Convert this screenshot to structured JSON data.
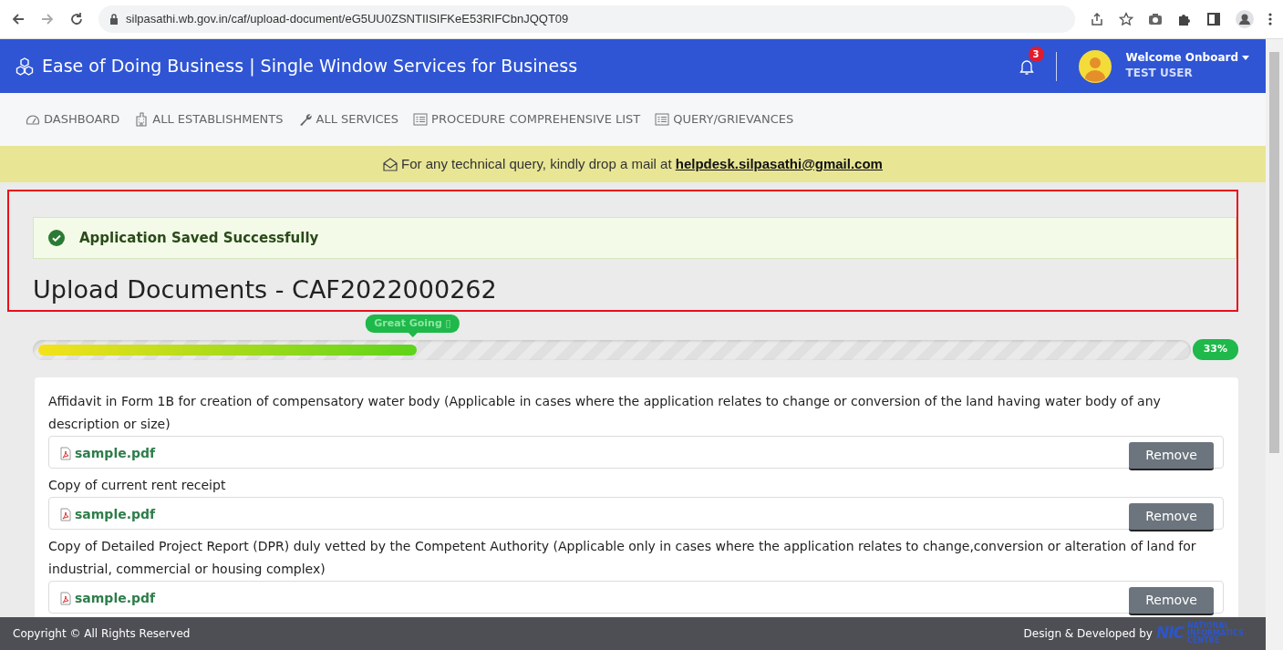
{
  "browser": {
    "url": "silpasathi.wb.gov.in/caf/upload-document/eG5UU0ZSNTIISIFKeE53RIFCbnJQQT09"
  },
  "header": {
    "title": "Ease of Doing Business | Single Window Services for Business",
    "notification_count": "3",
    "welcome": "Welcome Onboard",
    "user": "TEST USER"
  },
  "nav": [
    {
      "label": "DASHBOARD"
    },
    {
      "label": "ALL ESTABLISHMENTS"
    },
    {
      "label": "ALL SERVICES"
    },
    {
      "label": "PROCEDURE COMPREHENSIVE LIST"
    },
    {
      "label": "QUERY/GRIEVANCES"
    }
  ],
  "banner": {
    "text": "For any technical query, kindly drop a mail at",
    "email": "helpdesk.silpasathi@gmail.com"
  },
  "alert": {
    "text": "Application Saved Successfully"
  },
  "title": "Upload Documents - CAF2022000262",
  "progress": {
    "level": 0.33,
    "tooltip": "Great Going ▯",
    "reading": "33%"
  },
  "documents": [
    {
      "label": "Affidavit in Form 1B for creation of compensatory water body (Applicable in cases where the application relates to change or conversion of the land having water body of any description or size)",
      "file": "sample.pdf",
      "button": "Remove"
    },
    {
      "label": "Copy of current rent receipt",
      "file": "sample.pdf",
      "button": "Remove"
    },
    {
      "label": "Copy of Detailed Project Report (DPR) duly vetted by the Competent Authority (Applicable only in cases where the application relates to change,conversion or alteration of land for industrial, commercial or housing complex)",
      "file": "sample.pdf",
      "button": "Remove"
    }
  ],
  "footer": {
    "copyright": "Copyright © All Rights Reserved",
    "credit": "Design & Developed by",
    "logo_text": "NIC",
    "logo_subtext": "NATIONAL INFORMATICS CENTRE"
  }
}
